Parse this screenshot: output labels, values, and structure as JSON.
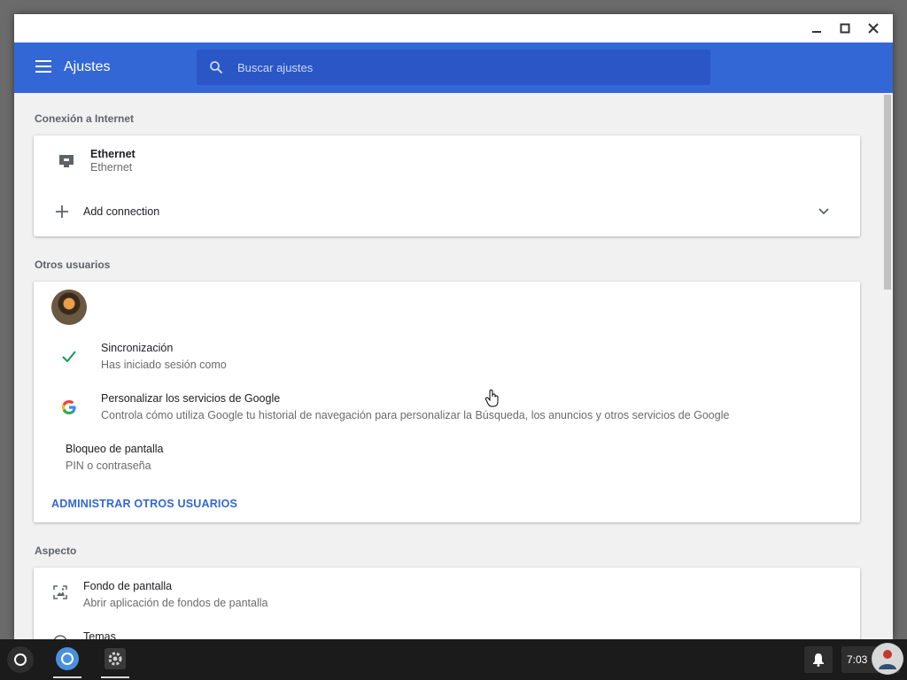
{
  "app": {
    "title": "Ajustes",
    "search_placeholder": "Buscar ajustes",
    "accent_color": "#3367d6"
  },
  "sections": {
    "internet": {
      "title": "Conexión a Internet",
      "ethernet_title": "Ethernet",
      "ethernet_subtitle": "Ethernet",
      "add_connection": "Add connection"
    },
    "users": {
      "title": "Otros usuarios",
      "sync_title": "Sincronización",
      "sync_subtitle": "Has iniciado sesión como",
      "google_title": "Personalizar los servicios de Google",
      "google_subtitle": "Controla cómo utiliza Google tu historial de navegación para personalizar la Búsqueda, los anuncios y otros servicios de Google",
      "lock_title": "Bloqueo de pantalla",
      "lock_subtitle": "PIN o contraseña",
      "manage_link": "ADMINISTRAR OTROS USUARIOS"
    },
    "appearance": {
      "title": "Aspecto",
      "wallpaper_title": "Fondo de pantalla",
      "wallpaper_subtitle": "Abrir aplicación de fondos de pantalla",
      "themes_title": "Temas"
    }
  },
  "shelf": {
    "clock": "7:03"
  }
}
